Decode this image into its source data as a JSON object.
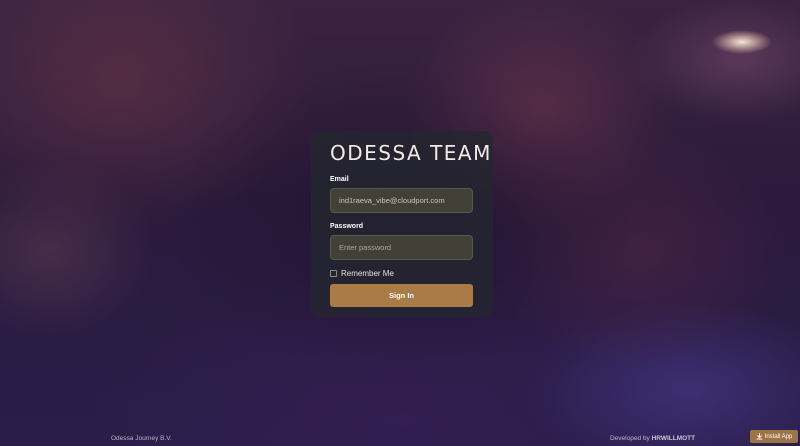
{
  "brand": {
    "logo_text": "ODESSA TEAM"
  },
  "login": {
    "email_label": "Email",
    "email_value": "ind1raeva_vibe@cloudport.com",
    "password_label": "Password",
    "password_placeholder": "Enter password",
    "remember_label": "Remember Me",
    "remember_checked": false,
    "signin_label": "Sign In"
  },
  "footer": {
    "company": "Odessa Journey B.V.",
    "developed_by": "Developed by",
    "developer": "HRWILLMOTT",
    "install_label": "Install App"
  },
  "colors": {
    "accent": "#a97b47",
    "card_bg": "#242630"
  },
  "icons": {
    "install": "download-icon"
  }
}
